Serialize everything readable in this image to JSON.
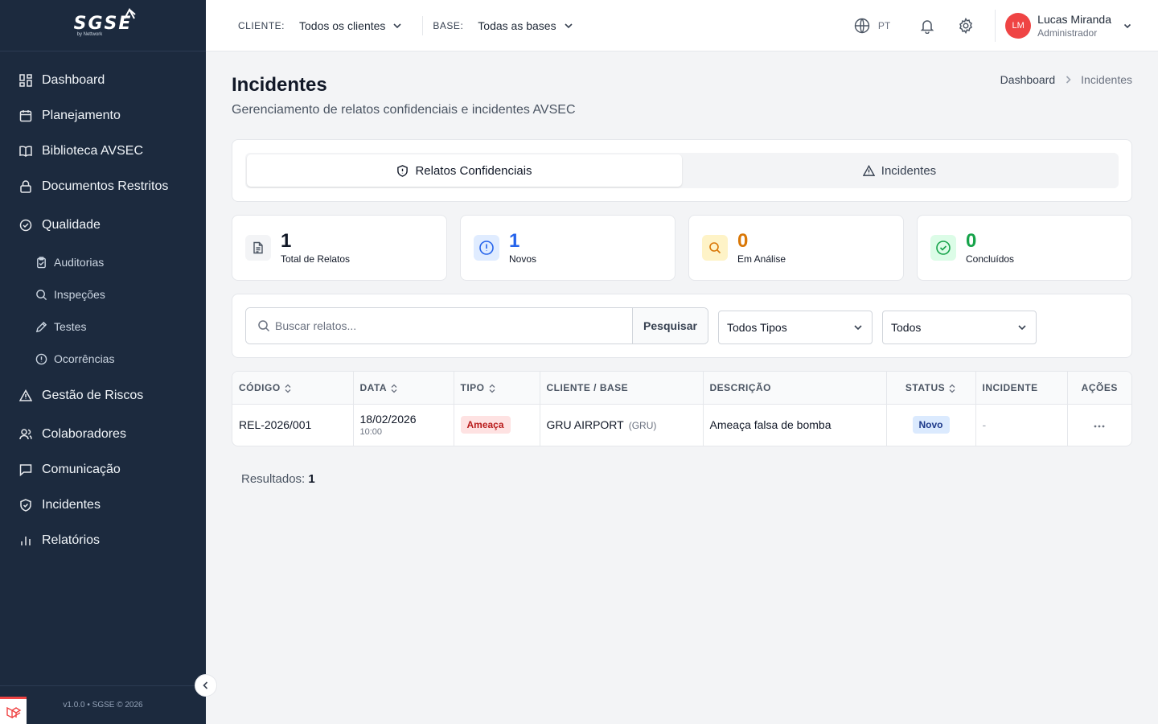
{
  "brand": {
    "logo_text": "SGSE",
    "logo_sub": "by Nettwork",
    "footer": "v1.0.0 • SGSE © 2026"
  },
  "sidebar": {
    "items": [
      {
        "label": "Dashboard",
        "icon": "dashboard-icon"
      },
      {
        "label": "Planejamento",
        "icon": "calendar-icon"
      },
      {
        "label": "Biblioteca AVSEC",
        "icon": "book-icon"
      },
      {
        "label": "Documentos Restritos",
        "icon": "lock-icon"
      },
      {
        "label": "Qualidade",
        "icon": "check-circle-icon"
      },
      {
        "label": "Gestão de Riscos",
        "icon": "warning-icon"
      },
      {
        "label": "Colaboradores",
        "icon": "users-icon"
      },
      {
        "label": "Comunicação",
        "icon": "chat-icon"
      },
      {
        "label": "Incidentes",
        "icon": "shield-icon"
      },
      {
        "label": "Relatórios",
        "icon": "bar-chart-icon"
      }
    ],
    "sub_items": [
      {
        "label": "Auditorias",
        "icon": "clipboard-icon"
      },
      {
        "label": "Inspeções",
        "icon": "search-icon"
      },
      {
        "label": "Testes",
        "icon": "pen-icon"
      },
      {
        "label": "Ocorrências",
        "icon": "alert-circle-icon"
      }
    ]
  },
  "topbar": {
    "client_label": "CLIENTE:",
    "client_value": "Todos os clientes",
    "base_label": "BASE:",
    "base_value": "Todas as bases",
    "lang": "PT",
    "user": {
      "initials": "LM",
      "name": "Lucas Miranda",
      "role": "Administrador"
    }
  },
  "page": {
    "title": "Incidentes",
    "subtitle": "Gerenciamento de relatos confidenciais e incidentes AVSEC",
    "breadcrumb": [
      "Dashboard",
      "Incidentes"
    ]
  },
  "tabs": [
    {
      "label": "Relatos Confidenciais",
      "active": true
    },
    {
      "label": "Incidentes",
      "active": false
    }
  ],
  "stats": [
    {
      "value": "1",
      "label": "Total de Relatos",
      "color": "#111827"
    },
    {
      "value": "1",
      "label": "Novos",
      "color": "#2563eb"
    },
    {
      "value": "0",
      "label": "Em Análise",
      "color": "#d97706"
    },
    {
      "value": "0",
      "label": "Concluídos",
      "color": "#16a34a"
    }
  ],
  "search": {
    "placeholder": "Buscar relatos...",
    "button": "Pesquisar"
  },
  "filters": {
    "type_value": "Todos Tipos",
    "status_value": "Todos"
  },
  "table": {
    "headers": [
      "CÓDIGO",
      "DATA",
      "TIPO",
      "CLIENTE / BASE",
      "DESCRIÇÃO",
      "STATUS",
      "INCIDENTE",
      "AÇÕES"
    ],
    "rows": [
      {
        "code": "REL-2026/001",
        "date": "18/02/2026",
        "time": "10:00",
        "type": "Ameaça",
        "client": "GRU AIRPORT",
        "base": "(GRU)",
        "description": "Ameaça falsa de bomba",
        "status": "Novo",
        "incident": "-"
      }
    ]
  },
  "results": {
    "label": "Resultados:",
    "count": "1"
  }
}
